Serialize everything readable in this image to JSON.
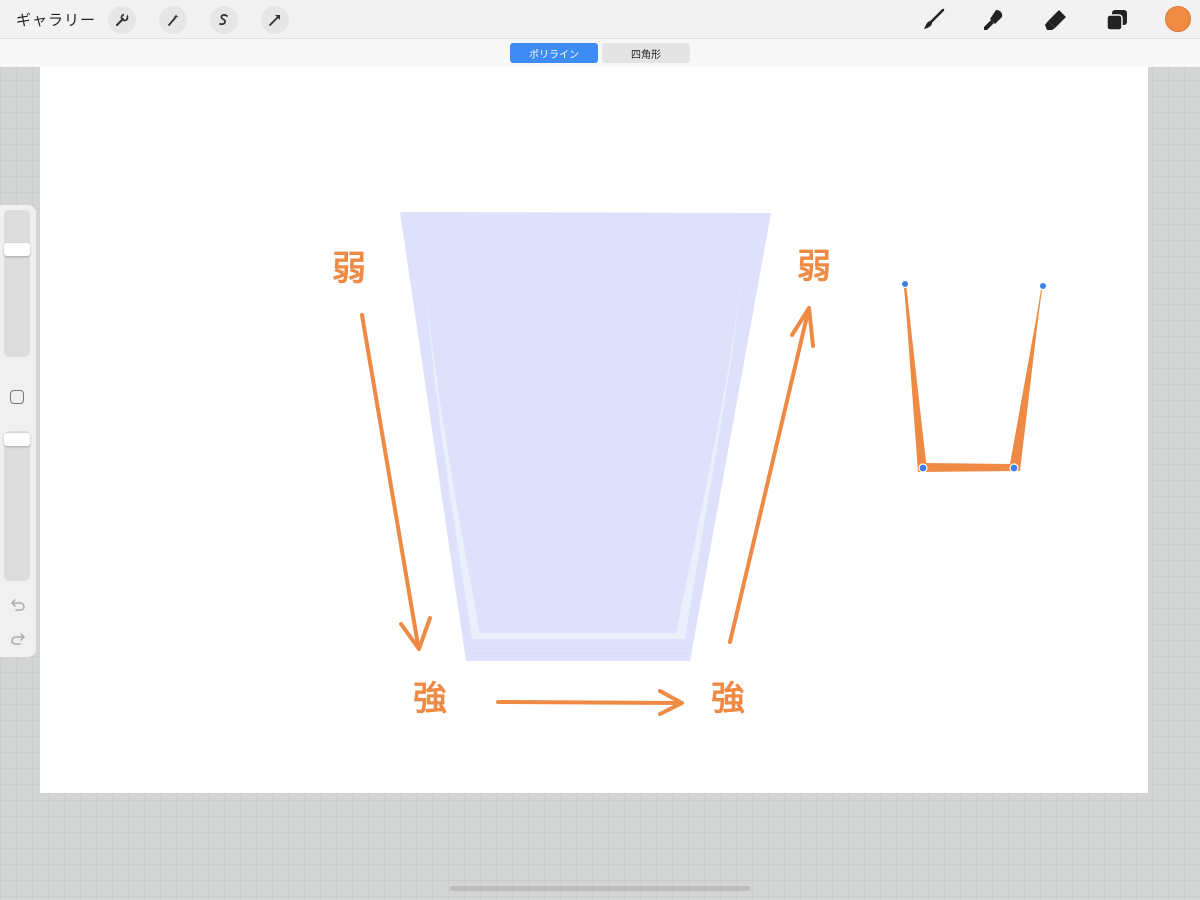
{
  "app": {
    "gallery_label": "ギャラリー",
    "left_tools": [
      "wrench-icon",
      "magic-wand-icon",
      "selection-icon",
      "transform-icon"
    ],
    "right_tools": [
      "brush-icon",
      "smudge-icon",
      "eraser-icon",
      "layers-icon"
    ],
    "current_color": "#ef8b43"
  },
  "shape_bar": {
    "polyline_label": "ポリライン",
    "rectangle_label": "四角形",
    "active": "polyline"
  },
  "canvas": {
    "label_weak_left": "弱",
    "label_strong_left": "強",
    "label_strong_right": "強",
    "label_weak_right": "弱",
    "accent_color": "#ee8a43",
    "cup_fill": "#dfe0fb",
    "cup_highlight": "#e8f0fb",
    "node_color": "#3c7fe6"
  },
  "sidebar": {
    "brush_size_fraction": 0.05,
    "opacity_fraction": 0.05
  }
}
